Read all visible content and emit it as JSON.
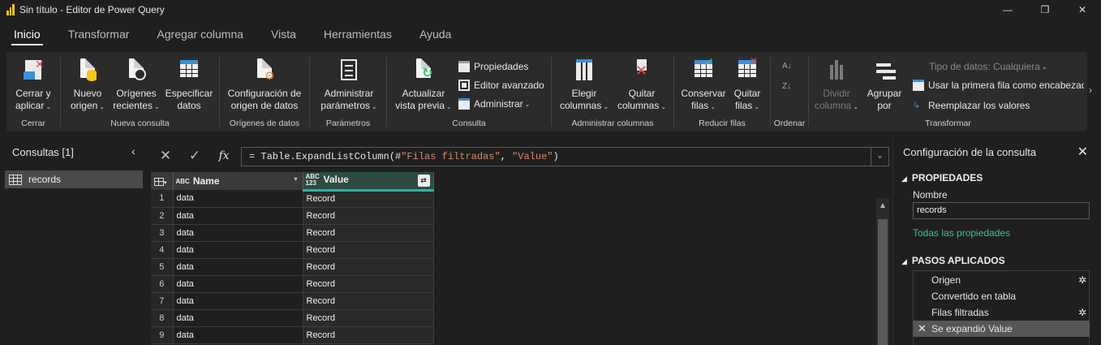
{
  "window": {
    "title": "Sin título - Editor de Power Query",
    "minimize": "—",
    "maximize": "❐",
    "close": "✕"
  },
  "tabs": [
    "Inicio",
    "Transformar",
    "Agregar columna",
    "Vista",
    "Herramientas",
    "Ayuda"
  ],
  "ribbon": {
    "groups": {
      "cerrar": "Cerrar",
      "nueva_consulta": "Nueva consulta",
      "origenes": "Orígenes de datos",
      "parametros": "Parámetros",
      "consulta": "Consulta",
      "admin_columnas": "Administrar columnas",
      "reducir_filas": "Reducir filas",
      "ordenar": "Ordenar",
      "transformar": "Transformar"
    },
    "buttons": {
      "cerrar_l1": "Cerrar y",
      "cerrar_l2": "aplicar",
      "nuevo_l1": "Nuevo",
      "nuevo_l2": "origen",
      "recientes_l1": "Orígenes",
      "recientes_l2": "recientes",
      "especificar_l1": "Especificar",
      "especificar_l2": "datos",
      "config_l1": "Configuración de",
      "config_l2": "origen de datos",
      "param_l1": "Administrar",
      "param_l2": "parámetros",
      "actualizar_l1": "Actualizar",
      "actualizar_l2": "vista previa",
      "propiedades": "Propiedades",
      "editor_avanzado": "Editor avanzado",
      "administrar": "Administrar",
      "elegir_l1": "Elegir",
      "elegir_l2": "columnas",
      "quitar_col_l1": "Quitar",
      "quitar_col_l2": "columnas",
      "conservar_l1": "Conservar",
      "conservar_l2": "filas",
      "quitar_filas_l1": "Quitar",
      "quitar_filas_l2": "filas",
      "dividir_l1": "Dividir",
      "dividir_l2": "columna",
      "agrupar_l1": "Agrupar",
      "agrupar_l2": "por",
      "tipo_datos": "Tipo de datos: Cualquiera",
      "primera_fila": "Usar la primera fila como encabezado",
      "reemplazar": "Reemplazar los valores"
    }
  },
  "queries": {
    "title": "Consultas [1]",
    "items": [
      {
        "name": "records"
      }
    ]
  },
  "formula": {
    "prefix": "= Table.ExpandListColumn(#",
    "arg1": "\"Filas filtradas\"",
    "sep": ", ",
    "arg2": "\"Value\"",
    "suffix": ")"
  },
  "grid": {
    "columns": [
      {
        "name": "Name",
        "type": "ABC"
      },
      {
        "name": "Value",
        "type": "ABC 123"
      }
    ],
    "rows": [
      {
        "n": "1",
        "name": "data",
        "value": "Record"
      },
      {
        "n": "2",
        "name": "data",
        "value": "Record"
      },
      {
        "n": "3",
        "name": "data",
        "value": "Record"
      },
      {
        "n": "4",
        "name": "data",
        "value": "Record"
      },
      {
        "n": "5",
        "name": "data",
        "value": "Record"
      },
      {
        "n": "6",
        "name": "data",
        "value": "Record"
      },
      {
        "n": "7",
        "name": "data",
        "value": "Record"
      },
      {
        "n": "8",
        "name": "data",
        "value": "Record"
      },
      {
        "n": "9",
        "name": "data",
        "value": "Record"
      }
    ]
  },
  "settings": {
    "title": "Configuración de la consulta",
    "properties_title": "PROPIEDADES",
    "name_label": "Nombre",
    "name_value": "records",
    "all_properties": "Todas las propiedades",
    "steps_title": "PASOS APLICADOS",
    "steps": [
      {
        "label": "Origen"
      },
      {
        "label": "Convertido en tabla"
      },
      {
        "label": "Filas filtradas"
      },
      {
        "label": "Se expandió Value"
      }
    ]
  }
}
